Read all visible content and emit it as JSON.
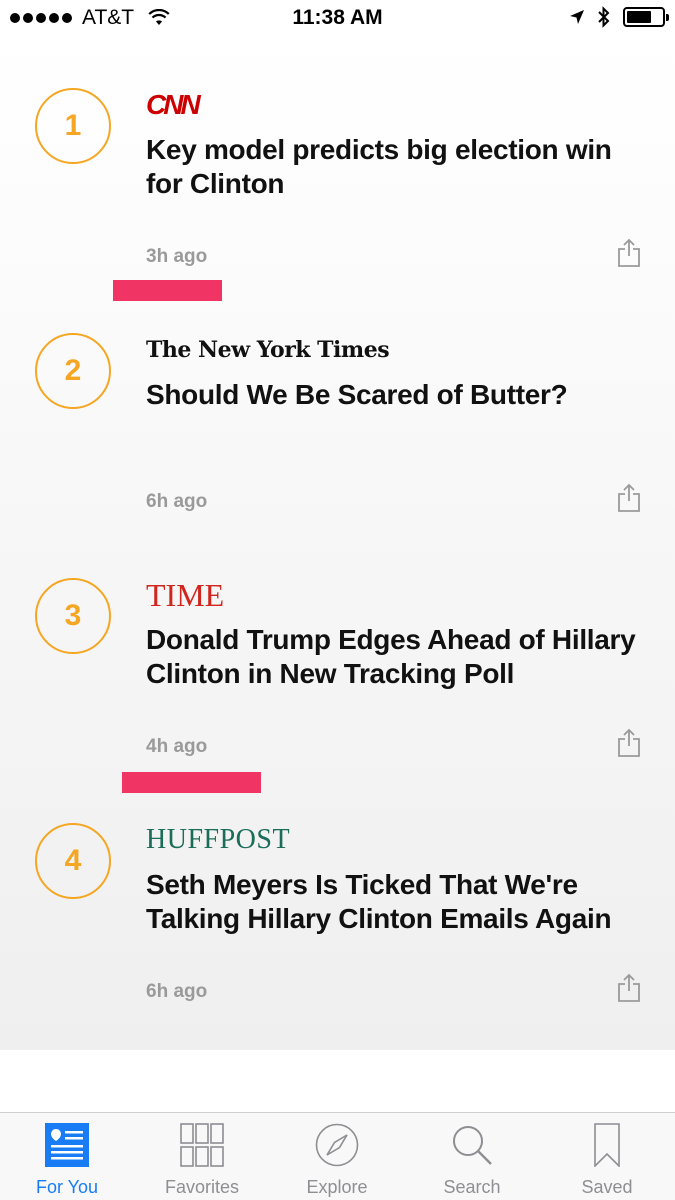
{
  "status_bar": {
    "carrier": "AT&T",
    "time": "11:38 AM",
    "battery_level": 0.7
  },
  "feed": {
    "items": [
      {
        "rank": "1",
        "source": "CNN",
        "headline": "Key model predicts big election win for Clinton",
        "time": "3h ago"
      },
      {
        "rank": "2",
        "source": "The New York Times",
        "headline": "Should We Be Scared of Butter?",
        "time": "6h ago"
      },
      {
        "rank": "3",
        "source": "TIME",
        "headline": "Donald Trump Edges Ahead of Hillary Clinton in New Tracking Poll",
        "time": "4h ago"
      },
      {
        "rank": "4",
        "source": "HUFFPOST",
        "headline": "Seth Meyers Is Ticked That We're Talking Hillary Clinton Emails Again",
        "time": "6h ago"
      }
    ]
  },
  "tab_bar": {
    "tabs": [
      {
        "label": "For You",
        "icon": "for-you-icon",
        "active": true
      },
      {
        "label": "Favorites",
        "icon": "favorites-grid-icon",
        "active": false
      },
      {
        "label": "Explore",
        "icon": "compass-icon",
        "active": false
      },
      {
        "label": "Search",
        "icon": "search-icon",
        "active": false
      },
      {
        "label": "Saved",
        "icon": "bookmark-icon",
        "active": false
      }
    ]
  },
  "colors": {
    "rank_accent": "#f5a623",
    "highlight": "#f03565",
    "tab_active": "#1a7cf4",
    "tab_inactive": "#8e8e93",
    "cnn_red": "#cc0000",
    "time_red": "#d0261e",
    "huffpost_green": "#1b6c58"
  }
}
